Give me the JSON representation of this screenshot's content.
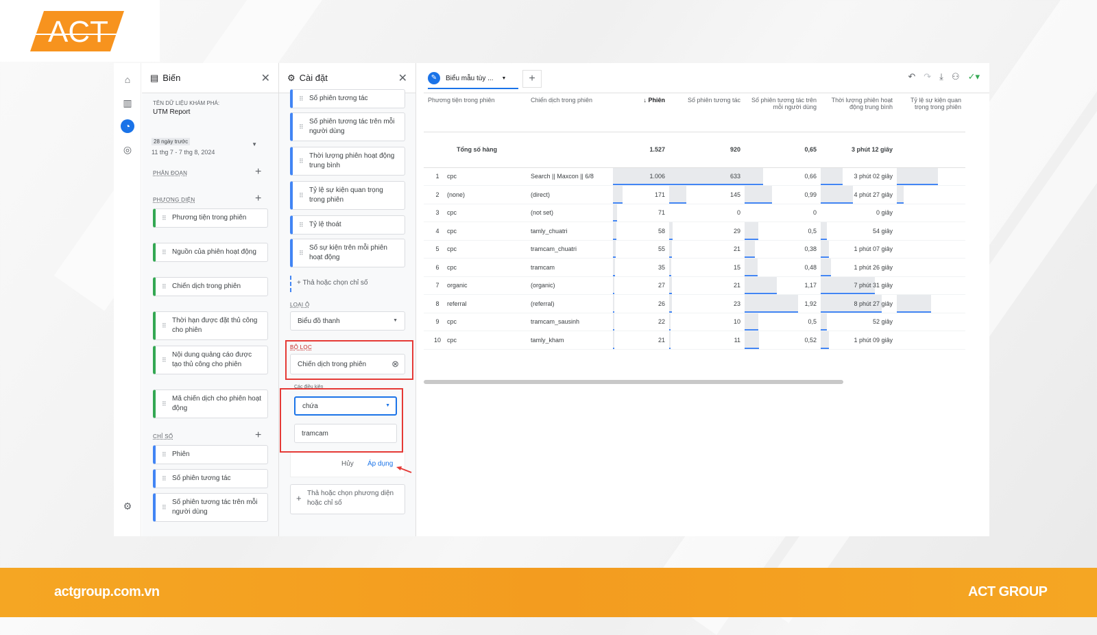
{
  "brand": {
    "logo_text": "ACT",
    "website": "actgroup.com.vn",
    "company": "ACT GROUP",
    "accent": "#f7931e"
  },
  "variables": {
    "title": "Biến",
    "explore_label": "TÊN DỮ LIỆU KHÁM PHÁ:",
    "explore_name": "UTM Report",
    "date_tag": "28 ngày trước",
    "date_range": "11 thg 7 - 7 thg 8, 2024",
    "segments_label": "PHÂN ĐOẠN",
    "dimensions_label": "PHƯƠNG DIỆN",
    "dimensions": [
      "Phương tiện trong phiên",
      "Nguồn của phiên hoạt động",
      "Chiến dịch trong phiên",
      "Thời hạn được đặt thủ công cho phiên",
      "Nội dung quảng cáo được tạo thủ công cho phiên",
      "Mã chiến dịch cho phiên hoạt động"
    ],
    "metrics_label": "CHỈ SỐ",
    "metrics": [
      "Phiên",
      "Số phiên tương tác",
      "Số phiên tương tác trên mỗi người dùng"
    ]
  },
  "settings": {
    "title": "Cài đặt",
    "metric_cards": [
      "Số phiên tương tác",
      "Số phiên tương tác trên mỗi người dùng",
      "Thời lượng phiên hoạt động trung bình",
      "Tỷ lệ sự kiện quan trọng trong phiên",
      "Tỷ lệ thoát",
      "Số sự kiện trên mỗi phiên hoạt động"
    ],
    "drop_metric": "Thả hoặc chọn chỉ số",
    "cell_type_label": "LOẠI Ô",
    "cell_type_value": "Biểu đồ thanh",
    "filter_label": "BỘ LỌC",
    "filter_dimension": "Chiến dịch trong phiên",
    "condition_label": "Các điều kiện",
    "condition_operator": "chứa",
    "condition_value": "tramcam",
    "cancel_label": "Hủy",
    "apply_label": "Áp dụng",
    "drop_dim_metric": "Thả hoặc chọn phương diện hoặc chỉ số"
  },
  "tab": {
    "label": "Biểu mẫu tùy ...",
    "add": "+"
  },
  "table": {
    "headers": [
      "Phương tiện trong phiên",
      "Chiến dịch trong phiên",
      "↓ Phiên",
      "Số phiên tương tác",
      "Số phiên tương tác trên mỗi người dùng",
      "Thời lượng phiên hoạt động trung bình",
      "Tỷ lệ sự kiện quan trọng trong phiên"
    ],
    "total": {
      "label": "Tổng số hàng",
      "sessions": "1.527",
      "engaged": "920",
      "per_user": "0,65",
      "duration": "3 phút 12 giây"
    },
    "rows": [
      {
        "n": "1",
        "medium": "cpc",
        "campaign": "Search || Maxcon || 6/8",
        "sessions": "1.006",
        "engaged": "633",
        "per_user": "0,66",
        "duration": "3 phút 02 giây",
        "s": 1006,
        "e": 633,
        "p": 0.66,
        "d": 182,
        "k": 0.6
      },
      {
        "n": "2",
        "medium": "(none)",
        "campaign": "(direct)",
        "sessions": "171",
        "engaged": "145",
        "per_user": "0,99",
        "duration": "4 phút 27 giây",
        "s": 171,
        "e": 145,
        "p": 0.99,
        "d": 267,
        "k": 0.1
      },
      {
        "n": "3",
        "medium": "cpc",
        "campaign": "(not set)",
        "sessions": "71",
        "engaged": "0",
        "per_user": "0",
        "duration": "0 giây",
        "s": 71,
        "e": 0,
        "p": 0,
        "d": 0,
        "k": 0
      },
      {
        "n": "4",
        "medium": "cpc",
        "campaign": "tamly_chuatri",
        "sessions": "58",
        "engaged": "29",
        "per_user": "0,5",
        "duration": "54 giây",
        "s": 58,
        "e": 29,
        "p": 0.5,
        "d": 54,
        "k": 0
      },
      {
        "n": "5",
        "medium": "cpc",
        "campaign": "tramcam_chuatri",
        "sessions": "55",
        "engaged": "21",
        "per_user": "0,38",
        "duration": "1 phút 07 giây",
        "s": 55,
        "e": 21,
        "p": 0.38,
        "d": 67,
        "k": 0
      },
      {
        "n": "6",
        "medium": "cpc",
        "campaign": "tramcam",
        "sessions": "35",
        "engaged": "15",
        "per_user": "0,48",
        "duration": "1 phút 26 giây",
        "s": 35,
        "e": 15,
        "p": 0.48,
        "d": 86,
        "k": 0
      },
      {
        "n": "7",
        "medium": "organic",
        "campaign": "(organic)",
        "sessions": "27",
        "engaged": "21",
        "per_user": "1,17",
        "duration": "7 phút 31 giây",
        "s": 27,
        "e": 21,
        "p": 1.17,
        "d": 451,
        "k": 0
      },
      {
        "n": "8",
        "medium": "referral",
        "campaign": "(referral)",
        "sessions": "26",
        "engaged": "23",
        "per_user": "1,92",
        "duration": "8 phút 27 giây",
        "s": 26,
        "e": 23,
        "p": 1.92,
        "d": 507,
        "k": 0.5
      },
      {
        "n": "9",
        "medium": "cpc",
        "campaign": "tramcam_sausinh",
        "sessions": "22",
        "engaged": "10",
        "per_user": "0,5",
        "duration": "52 giây",
        "s": 22,
        "e": 10,
        "p": 0.5,
        "d": 52,
        "k": 0
      },
      {
        "n": "10",
        "medium": "cpc",
        "campaign": "tamly_kham",
        "sessions": "21",
        "engaged": "11",
        "per_user": "0,52",
        "duration": "1 phút 09 giây",
        "s": 21,
        "e": 11,
        "p": 0.52,
        "d": 69,
        "k": 0
      }
    ]
  }
}
